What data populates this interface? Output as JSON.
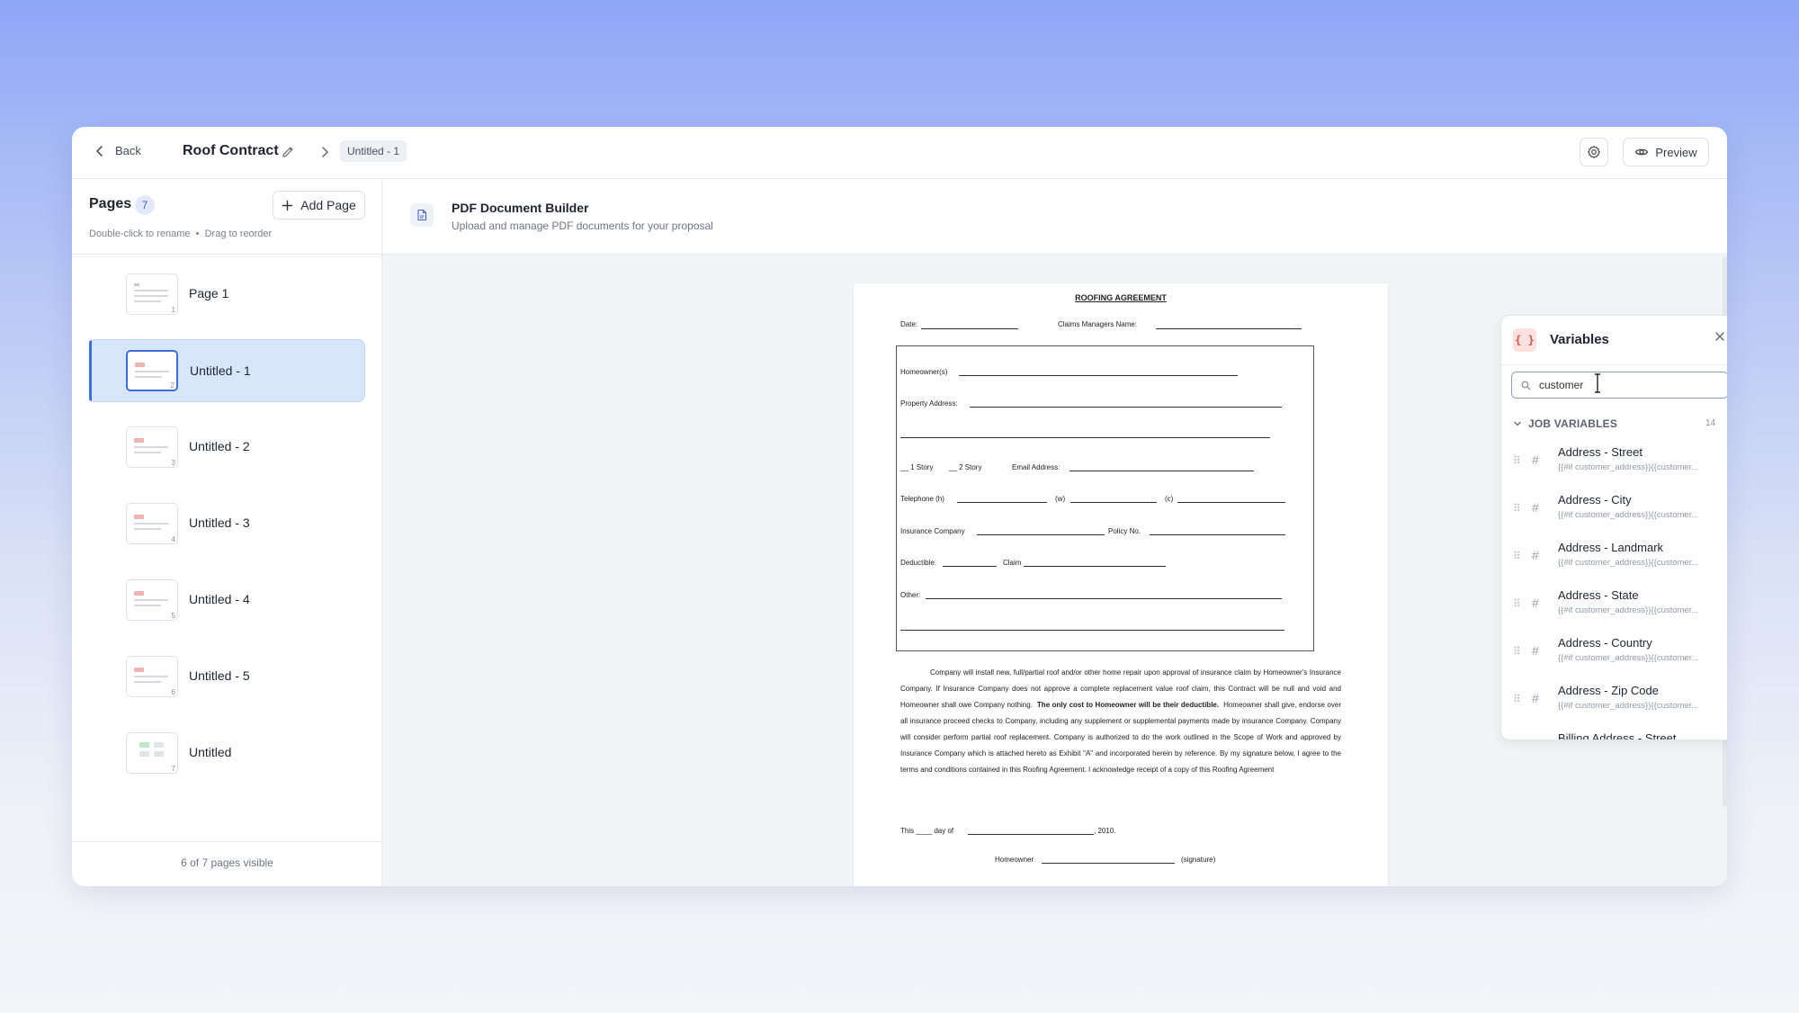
{
  "topbar": {
    "back_label": "Back",
    "doc_title": "Roof Contract",
    "breadcrumb_current": "Untitled - 1",
    "preview_label": "Preview"
  },
  "sidebar": {
    "title": "Pages",
    "count": "7",
    "add_page_label": "Add Page",
    "hint_rename": "Double-click to rename",
    "hint_separator": "•",
    "hint_reorder": "Drag to reorder",
    "footer": "6 of 7 pages visible",
    "pages": [
      {
        "label": "Page 1",
        "num": "1"
      },
      {
        "label": "Untitled - 1",
        "num": "2"
      },
      {
        "label": "Untitled - 2",
        "num": "3"
      },
      {
        "label": "Untitled - 3",
        "num": "4"
      },
      {
        "label": "Untitled - 4",
        "num": "5"
      },
      {
        "label": "Untitled - 5",
        "num": "6"
      },
      {
        "label": "Untitled",
        "num": "7"
      }
    ]
  },
  "main": {
    "title": "PDF Document Builder",
    "subtitle": "Upload and manage PDF documents for your proposal"
  },
  "document": {
    "heading": "ROOFING AGREEMENT",
    "date_label": "Date:",
    "claims_label": "Claims Managers Name:",
    "homeowner_label": "Homeowner(s)",
    "property_label": "Property Address:",
    "story1": "__ 1 Story",
    "story2": "__ 2 Story",
    "email_label": "Email Address:",
    "telephone_label": "Telephone (h)",
    "w_label": "(w)",
    "c_label": "(c)",
    "insurance_label": "Insurance Company",
    "policy_label": "Policy No.",
    "deductible_label": "Deductible:",
    "claim_label": "Claim",
    "other_label": "Other:",
    "para_1": "Company will install new, full/partial roof and/or other home repair upon approval of insurance claim by Homeowner's Insurance Company.  If Insurance Company does not approve a complete replacement value roof claim, this Contract will be null and void and Homeowner shall owe Company nothing.",
    "para_bold": "The only cost to Homeowner will be their deductible.",
    "para_2": "Homeowner shall give, endorse over all insurance proceed checks to Company, including any supplement or supplemental payments made by insurance Company.  Company will consider perform partial roof replacement.  Company is authorized to do the work outlined in the Scope of Work and approved by Insurance Company which is attached hereto as Exhibit \"A\" and incorporated herein by reference.  By my signature below, I agree to the terms and conditions contained in this Roofing Agreement.  I acknowledge receipt of a copy of this Roofing Agreement",
    "this_label": "This ____ day of",
    "year_label": ", 2010.",
    "homeowner_sig_label": "Homeowner",
    "signature_label": "(signature)"
  },
  "variables": {
    "title": "Variables",
    "search_value": "customer",
    "group_label": "JOB VARIABLES",
    "group_count": "14",
    "items": [
      {
        "name": "Address - Street",
        "code": "{{#if customer_address}}{{customer..."
      },
      {
        "name": "Address - City",
        "code": "{{#if customer_address}}{{customer..."
      },
      {
        "name": "Address - Landmark",
        "code": "{{#if customer_address}}{{customer..."
      },
      {
        "name": "Address - State",
        "code": "{{#if customer_address}}{{customer..."
      },
      {
        "name": "Address - Country",
        "code": "{{#if customer_address}}{{customer..."
      },
      {
        "name": "Address - Zip Code",
        "code": "{{#if customer_address}}{{customer..."
      },
      {
        "name": "Billing Address - Street",
        "code": ""
      }
    ]
  },
  "icons": {
    "back": "chevron-left-icon",
    "edit": "pencil-icon",
    "breadcrumb": "chevron-right-icon",
    "settings": "gear-icon",
    "preview": "eye-icon",
    "add": "plus-icon",
    "pdf": "file-icon",
    "variables": "braces-icon",
    "close": "close-icon",
    "search": "search-icon",
    "signature": "signature-icon",
    "zoom_in": "zoom-in-icon",
    "zoom_out": "zoom-out-icon"
  },
  "colors": {
    "accent": "#3c6fd8",
    "active_bg": "#d8e6fb",
    "variables_accent": "#d9534f",
    "variables_bg": "#fde0e0"
  }
}
